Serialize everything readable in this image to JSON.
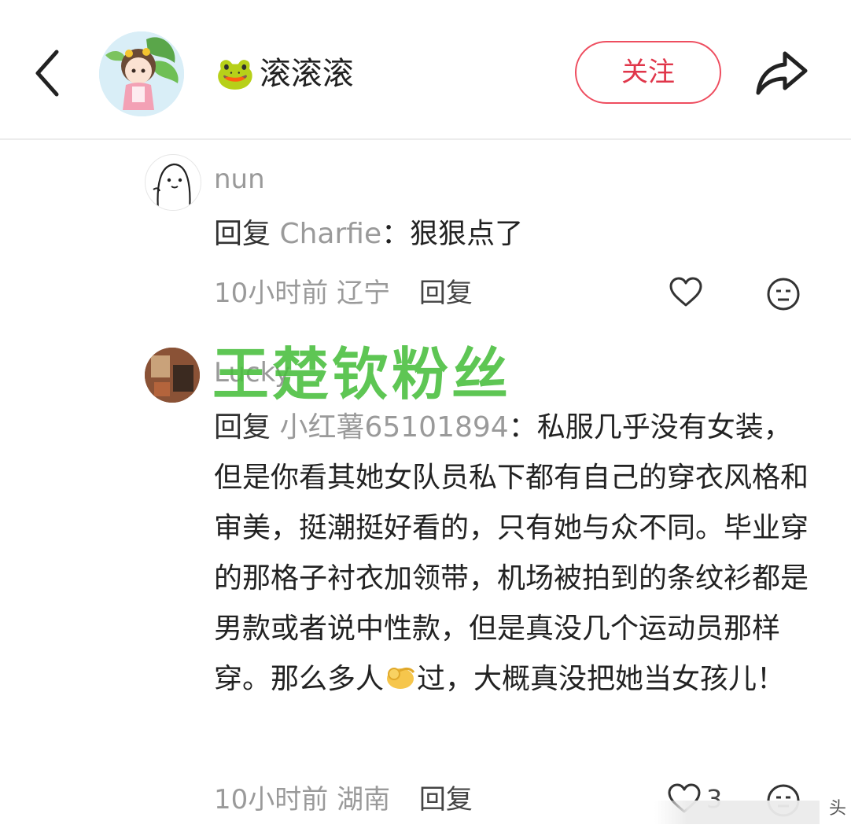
{
  "header": {
    "author_name": "滚滚滚",
    "author_emoji": "🐸",
    "follow_label": "关注"
  },
  "comments": [
    {
      "username": "nun",
      "reply_word": "回复",
      "mention": "Charfie",
      "separator": "：",
      "text": "狠狠点了",
      "time": "10小时前",
      "location": "辽宁",
      "reply_label": "回复"
    },
    {
      "username": "Lucky",
      "reply_word": "回复",
      "mention": "小红薯65101894",
      "separator": "：",
      "text_part1": "私服几乎没有女装，但是你看其她女队员私下都有自己的穿衣风格和审美，挺潮挺好看的，只有她与众不同。毕业穿的那格子衬衣加领带，机场被拍到的条纹衫都是男款或者说中性款，但是真没几个运动员那样穿。那么多人",
      "text_part2": "过，大概真没把她当女孩儿！",
      "time": "10小时前",
      "location": "湖南",
      "reply_label": "回复",
      "like_count": "3"
    }
  ],
  "overlay": {
    "watermark": "王楚钦粉丝",
    "site_mark": "头"
  },
  "colors": {
    "accent": "#e0364a",
    "muted": "#9a9a9a",
    "watermark": "#48be3c"
  }
}
